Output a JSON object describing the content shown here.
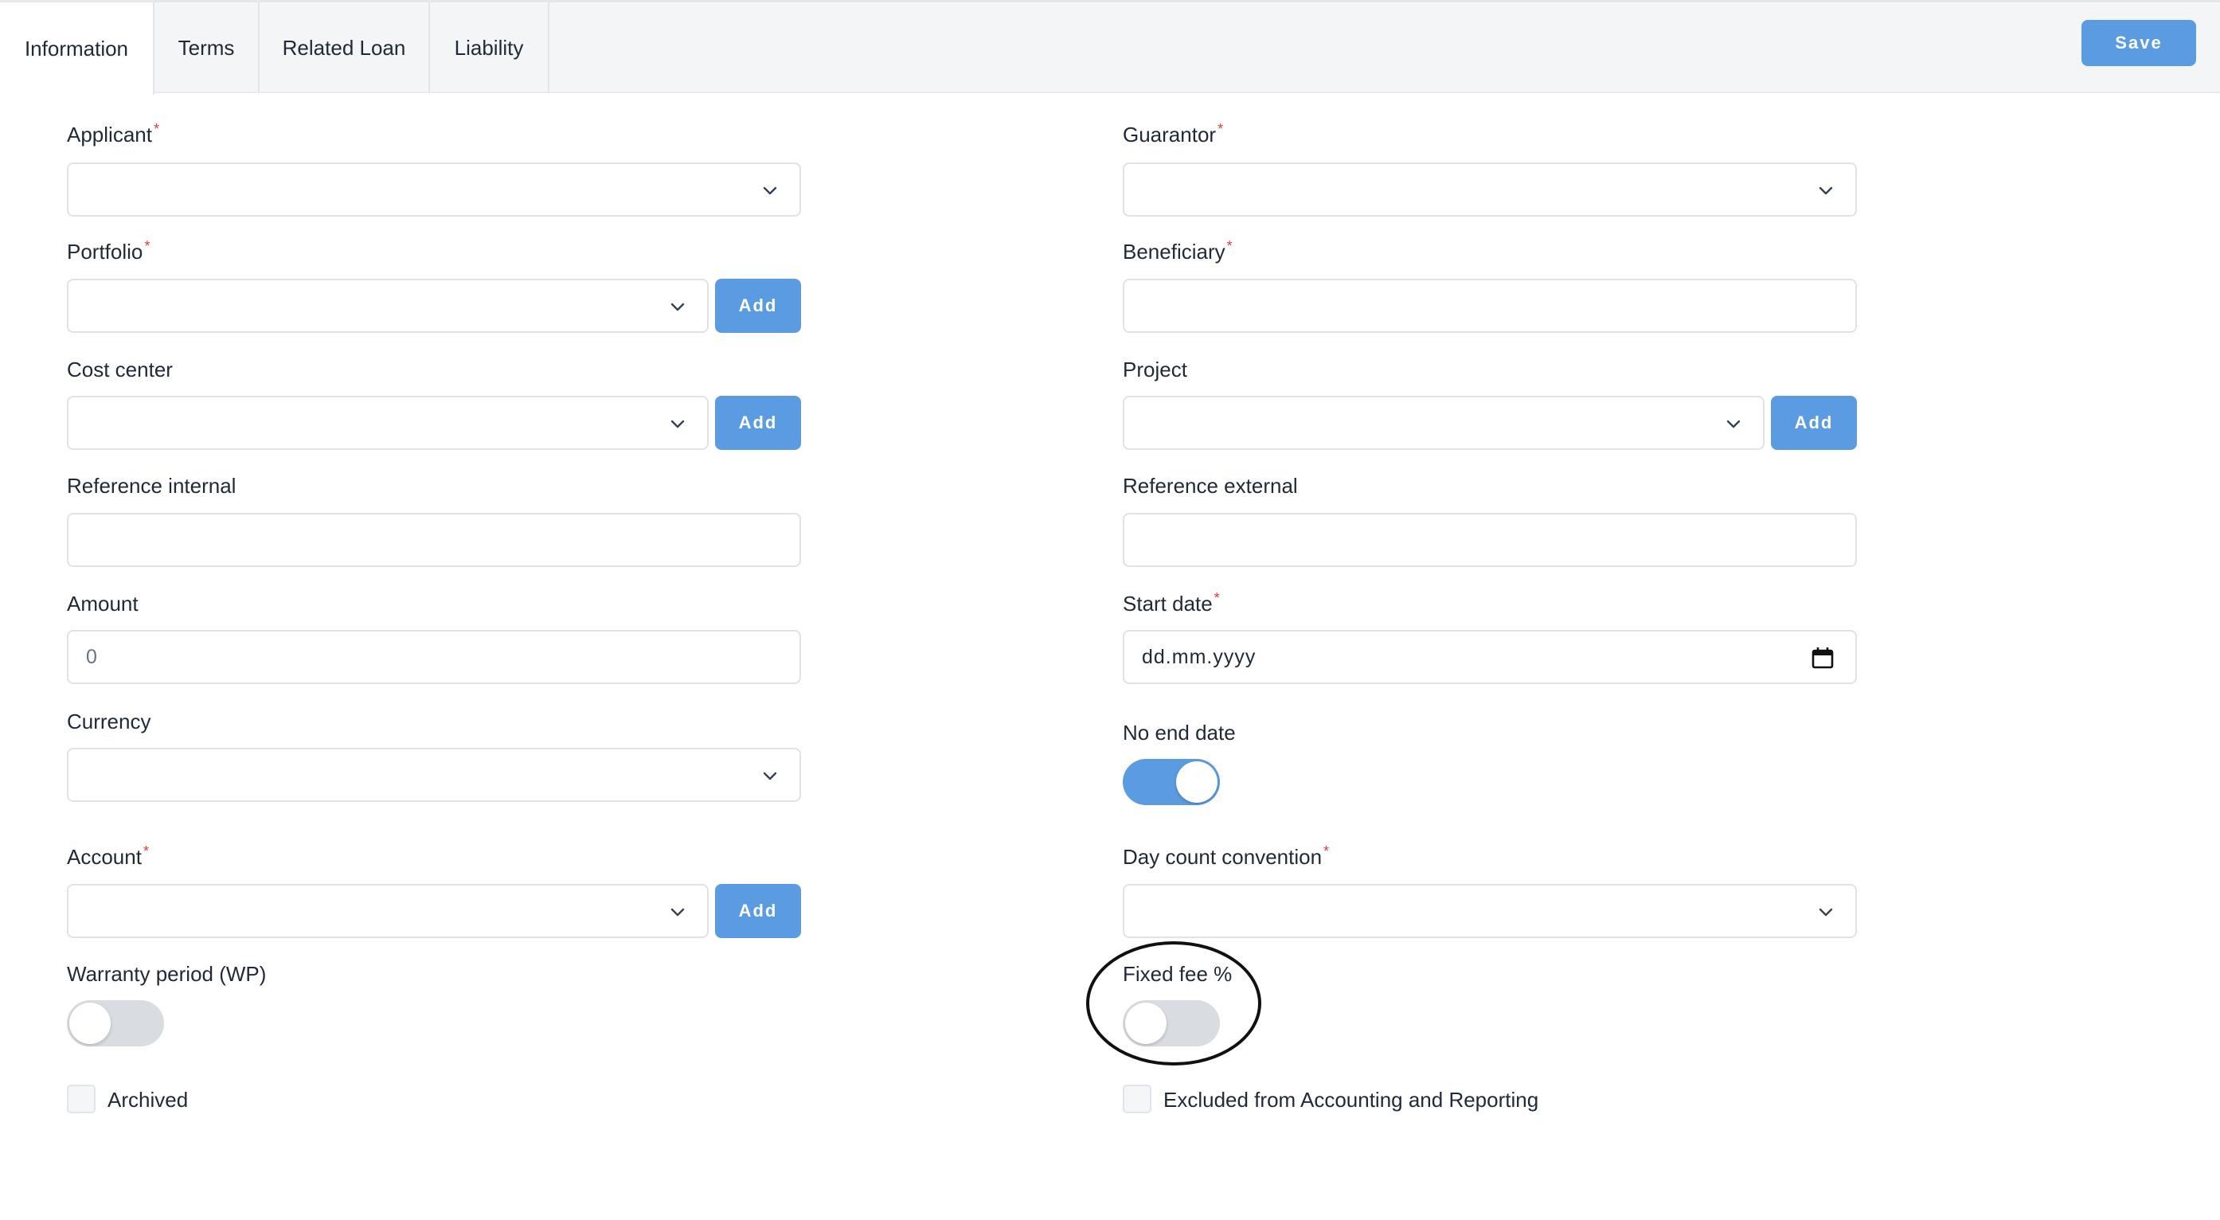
{
  "tabs": [
    {
      "label": "Information"
    },
    {
      "label": "Terms"
    },
    {
      "label": "Related Loan"
    },
    {
      "label": "Liability"
    }
  ],
  "save_label": "Save",
  "add_label": "Add",
  "required_mark": "*",
  "left": {
    "applicant": {
      "label": "Applicant",
      "value": ""
    },
    "portfolio": {
      "label": "Portfolio",
      "value": ""
    },
    "cost_center": {
      "label": "Cost center",
      "value": ""
    },
    "reference_internal": {
      "label": "Reference internal",
      "value": ""
    },
    "amount": {
      "label": "Amount",
      "placeholder": "0"
    },
    "currency": {
      "label": "Currency",
      "value": ""
    },
    "account": {
      "label": "Account",
      "value": ""
    },
    "warranty_period": {
      "label": "Warranty period (WP)",
      "enabled": false
    },
    "archived": {
      "label": "Archived",
      "checked": false
    }
  },
  "right": {
    "guarantor": {
      "label": "Guarantor",
      "value": ""
    },
    "beneficiary": {
      "label": "Beneficiary",
      "value": ""
    },
    "project": {
      "label": "Project",
      "value": ""
    },
    "reference_external": {
      "label": "Reference external",
      "value": ""
    },
    "start_date": {
      "label": "Start date",
      "placeholder": "dd.mm.yyyy"
    },
    "no_end_date": {
      "label": "No end date",
      "enabled": true
    },
    "day_count_convention": {
      "label": "Day count convention",
      "value": ""
    },
    "fixed_fee": {
      "label": "Fixed fee %",
      "enabled": false
    },
    "excluded": {
      "label": "Excluded from Accounting and Reporting",
      "checked": false
    }
  },
  "colors": {
    "accent": "#5b9be2",
    "required": "#e23b3b",
    "tabbar_bg": "#f3f5f7",
    "toggle_off": "#d9dce1"
  },
  "icons": {
    "dropdown": "chevron-down-icon",
    "date": "calendar-icon"
  }
}
